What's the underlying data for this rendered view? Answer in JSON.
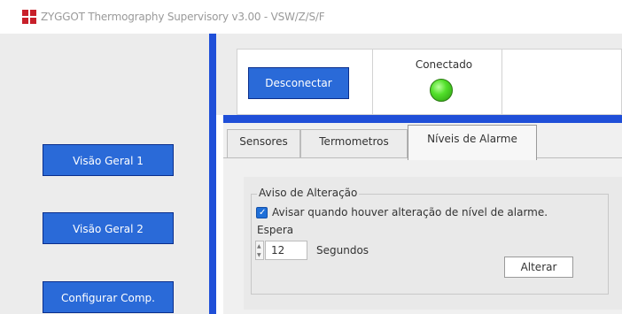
{
  "window": {
    "title": "ZYGGOT Thermography Supervisory v3.00 - VSW/Z/S/F",
    "logo_icon": "app-logo-icon",
    "logo_color": "#c8202a"
  },
  "sidebar": {
    "buttons": [
      {
        "label": "Visão Geral 1"
      },
      {
        "label": "Visão Geral 2"
      },
      {
        "label": "Configurar Comp."
      }
    ]
  },
  "connection": {
    "button_label": "Desconectar",
    "status_label": "Conectado",
    "status_color": "#52e02a"
  },
  "tabs": [
    {
      "label": "Sensores",
      "active": false
    },
    {
      "label": "Termometros",
      "active": false
    },
    {
      "label": "Níveis de Alarme",
      "active": true
    }
  ],
  "alarm_change": {
    "group_title": "Aviso de Alteração",
    "checkbox_label": "Avisar quando houver alteração de nível de alarme.",
    "checkbox_checked": true,
    "wait_label": "Espera",
    "wait_value": "12",
    "wait_unit": "Segundos",
    "apply_button": "Alterar"
  },
  "colors": {
    "accent_blue": "#1f4fd8",
    "button_blue": "#2a6ad8"
  }
}
